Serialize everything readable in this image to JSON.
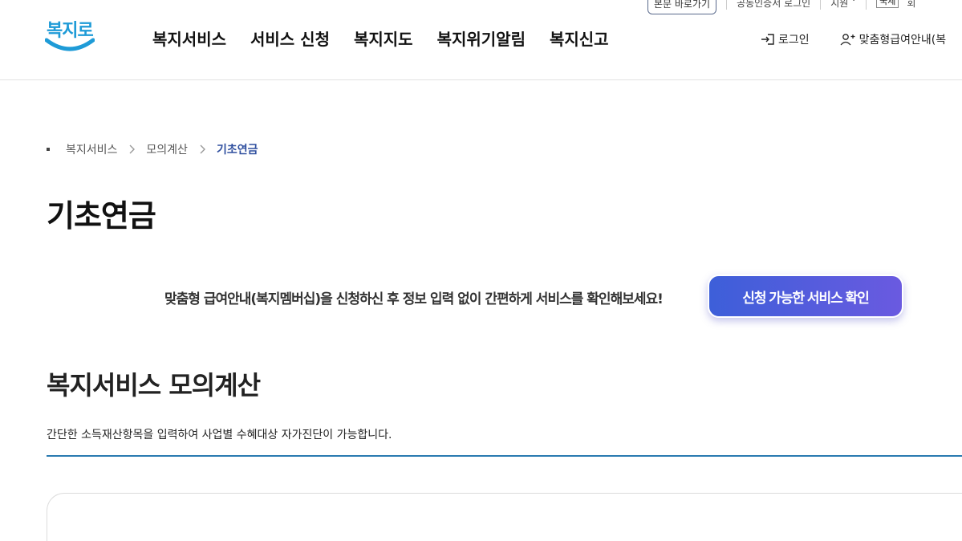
{
  "header": {
    "util": {
      "main_content_button": "본문 바로가기",
      "public_cert_link": "공동인증서 로그인",
      "lang_label": "지원",
      "box_label": "국제",
      "cut_label": "회"
    },
    "logo_text": "복지로",
    "nav": [
      {
        "label": "복지서비스"
      },
      {
        "label": "서비스 신청"
      },
      {
        "label": "복지지도"
      },
      {
        "label": "복지위기알림"
      },
      {
        "label": "복지신고"
      }
    ],
    "login_label": "로그인",
    "member_label": "맞춤형급여안내(복"
  },
  "breadcrumb": {
    "items": [
      "복지서비스",
      "모의계산",
      "기초연금"
    ]
  },
  "page_title": "기초연금",
  "promo": {
    "text": "맞춤형 급여안내(복지멤버십)을 신청하신 후 정보 입력 없이 간편하게 서비스를 확인해보세요!",
    "button_label": "신청 가능한 서비스 확인"
  },
  "section": {
    "title": "복지서비스 모의계산",
    "description": "간단한 소득재산항목을 입력하여 사업별 수혜대상 자가진단이 가능합니다."
  },
  "colors": {
    "brand": "#1e9bd7",
    "accent_start": "#3d5fd9",
    "accent_end": "#6a5ae0",
    "breadcrumb_current": "#2f4f9f",
    "section_line": "#2a7ab0"
  }
}
